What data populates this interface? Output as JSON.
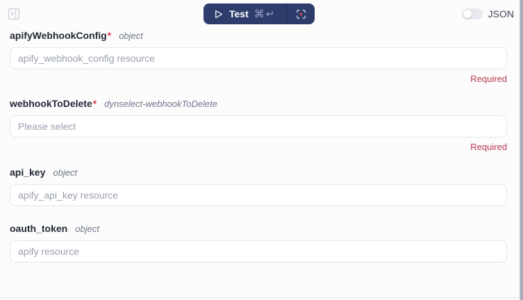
{
  "topbar": {
    "panel_icon": "panel-right-open-icon",
    "test_button": {
      "label": "Test",
      "shortcut": "⌘↵",
      "play_icon": "play-icon",
      "retry_icon": "focus-target-icon"
    },
    "json_toggle": {
      "label": "JSON",
      "state": "off"
    }
  },
  "fields": [
    {
      "name": "apifyWebhookConfig",
      "required_marker": "*",
      "type_hint": "object",
      "value": "",
      "placeholder": "apify_webhook_config resource",
      "error": "Required"
    },
    {
      "name": "webhookToDelete",
      "required_marker": "*",
      "type_hint": "dynselect-webhookToDelete",
      "value": "",
      "placeholder": "Please select",
      "error": "Required"
    },
    {
      "name": "api_key",
      "required_marker": "",
      "type_hint": "object",
      "value": "",
      "placeholder": "apify_api_key resource",
      "error": ""
    },
    {
      "name": "oauth_token",
      "required_marker": "",
      "type_hint": "object",
      "value": "",
      "placeholder": "apify resource",
      "error": ""
    }
  ],
  "colors": {
    "accent_navy": "#2e3c6c",
    "error_red": "#b8394e",
    "asterisk_red": "#e0394a",
    "placeholder_gray": "#9aa0ac",
    "border_gray": "#e3e5ea",
    "scrollbar_gray": "#a9aeba"
  }
}
